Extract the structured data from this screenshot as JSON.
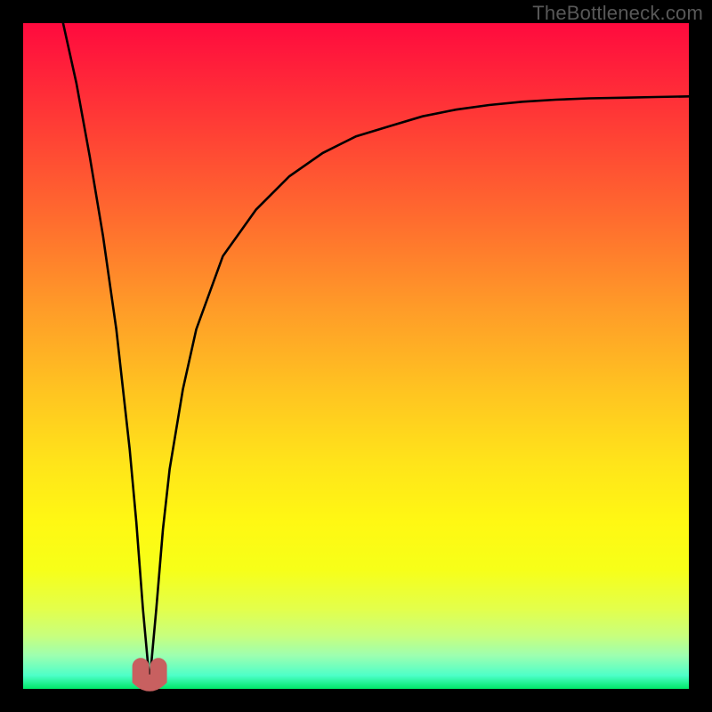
{
  "watermark": "TheBottleneck.com",
  "colors": {
    "frame": "#000000",
    "curve": "#000000",
    "marker": "#c86060",
    "gradient_top": "#ff0a3e",
    "gradient_bottom": "#00e868"
  },
  "chart_data": {
    "type": "line",
    "title": "",
    "xlabel": "",
    "ylabel": "",
    "xlim": [
      0,
      100
    ],
    "ylim": [
      0,
      100
    ],
    "note": "Axes unlabeled; values estimated from pixel positions on a 0–100 scale where (0,0) is bottom-left. The curve plunges from top-left to a minimum near x≈19 at y≈1, then rises with decreasing slope toward the right edge at y≈89.",
    "marker": {
      "x": 19,
      "y": 1.5,
      "radius_px": 10
    },
    "series": [
      {
        "name": "bottleneck-curve",
        "x": [
          6,
          8,
          10,
          12,
          14,
          16,
          17,
          18,
          19,
          20,
          21,
          22,
          24,
          26,
          30,
          35,
          40,
          45,
          50,
          55,
          60,
          65,
          70,
          75,
          80,
          85,
          90,
          95,
          100
        ],
        "y": [
          100,
          91,
          80,
          68,
          54,
          36,
          25,
          12,
          1,
          12,
          24,
          33,
          45,
          54,
          65,
          72,
          77,
          80.5,
          83,
          84.5,
          86,
          87,
          87.7,
          88.2,
          88.5,
          88.7,
          88.8,
          88.9,
          89
        ]
      }
    ]
  }
}
